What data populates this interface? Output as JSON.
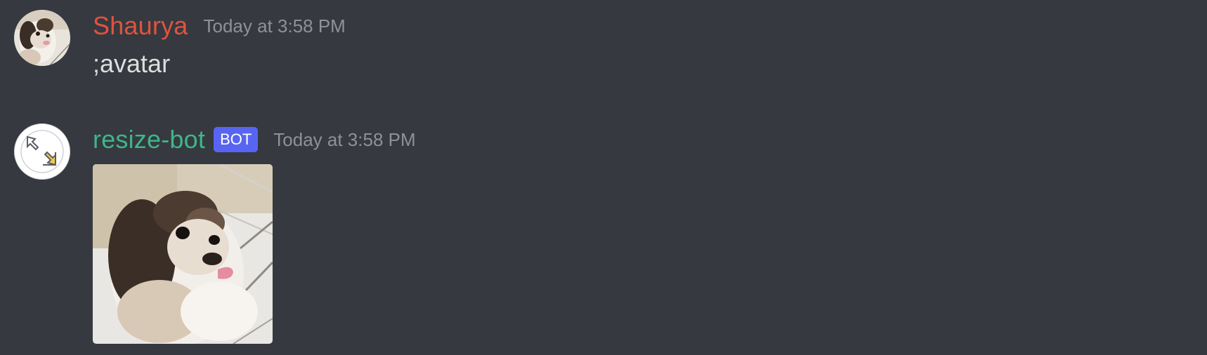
{
  "messages": [
    {
      "author": "Shaurya",
      "author_color": "#e0533f",
      "timestamp": "Today at 3:58 PM",
      "text": ";avatar",
      "avatar_icon": "dog-photo-avatar"
    },
    {
      "author": "resize-bot",
      "author_color": "#3fb58a",
      "badge": "BOT",
      "badge_color": "#5865f2",
      "timestamp": "Today at 3:58 PM",
      "avatar_icon": "resize-arrows-icon",
      "attachment_icon": "dog-photo-attachment"
    }
  ],
  "theme": {
    "background": "#36393f",
    "text": "#dcddde",
    "muted": "#8e9297"
  }
}
